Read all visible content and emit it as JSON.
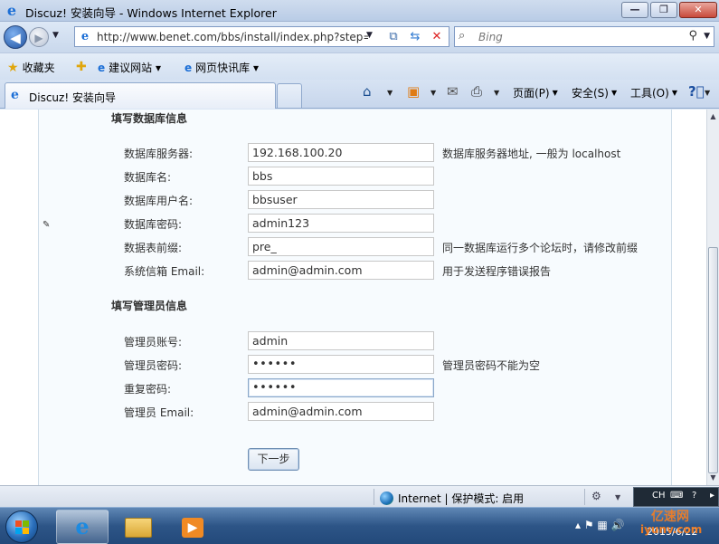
{
  "window": {
    "title": "Discuz! 安装向导 - Windows Internet Explorer",
    "buttons": {
      "minimize": "—",
      "maximize": "❐",
      "close": "✕"
    }
  },
  "address_bar": {
    "url": "http://www.benet.com/bbs/install/index.php?step=",
    "search_placeholder": "Bing"
  },
  "favorites_bar": {
    "favorites_label": "收藏夹",
    "items": [
      "建议网站 ▾",
      "网页快讯库 ▾"
    ]
  },
  "tabs": [
    {
      "label": "Discuz! 安装向导"
    }
  ],
  "command_bar": {
    "page": "页面(P)",
    "safety": "安全(S)",
    "tools": "工具(O)"
  },
  "form": {
    "db_section_title": "填写数据库信息",
    "db_fields": [
      {
        "label": "数据库服务器:",
        "value": "192.168.100.20",
        "hint": "数据库服务器地址, 一般为 localhost"
      },
      {
        "label": "数据库名:",
        "value": "bbs",
        "hint": ""
      },
      {
        "label": "数据库用户名:",
        "value": "bbsuser",
        "hint": ""
      },
      {
        "label": "数据库密码:",
        "value": "admin123",
        "hint": ""
      },
      {
        "label": "数据表前缀:",
        "value": "pre_",
        "hint": "同一数据库运行多个论坛时，请修改前缀"
      },
      {
        "label": "系统信箱 Email:",
        "value": "admin@admin.com",
        "hint": "用于发送程序错误报告"
      }
    ],
    "admin_section_title": "填写管理员信息",
    "admin_fields": [
      {
        "label": "管理员账号:",
        "value": "admin",
        "hint": ""
      },
      {
        "label": "管理员密码:",
        "value": "••••••",
        "hint": "管理员密码不能为空"
      },
      {
        "label": "重复密码:",
        "value": "••••••",
        "hint": ""
      },
      {
        "label": "管理员 Email:",
        "value": "admin@admin.com",
        "hint": ""
      }
    ],
    "next_button": "下一步"
  },
  "status_bar": {
    "zone": "Internet | 保护模式: 启用"
  },
  "ime": {
    "lang": "CH"
  },
  "taskbar": {
    "date": "2015/6/22",
    "watermark": "亿速网",
    "watermark_url": "iyunv.com"
  }
}
